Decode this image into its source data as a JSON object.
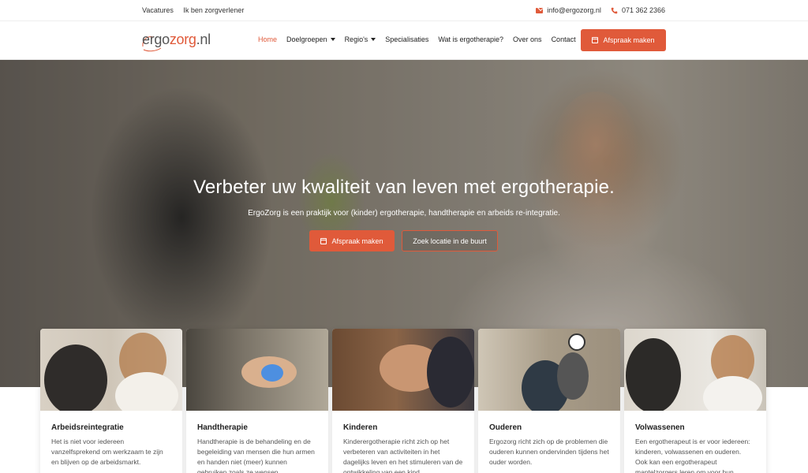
{
  "topbar": {
    "links": [
      "Vacatures",
      "Ik ben zorgverlener"
    ],
    "email": "info@ergozorg.nl",
    "phone": "071 362 2366"
  },
  "logo": {
    "text_a": "ergo",
    "text_b": "zorg",
    "text_c": ".nl"
  },
  "nav": {
    "home": "Home",
    "doelgroepen": "Doelgroepen",
    "regios": "Regio's",
    "specialisaties": "Specialisaties",
    "wat": "Wat is ergotherapie?",
    "over": "Over ons",
    "contact": "Contact",
    "cta": "Afspraak maken"
  },
  "hero": {
    "title": "Verbeter uw kwaliteit van leven met ergotherapie.",
    "subtitle": "ErgoZorg is een praktijk voor (kinder) ergotherapie, handtherapie en arbeids re-integratie.",
    "primary_button": "Afspraak maken",
    "secondary_button": "Zoek locatie in de buurt"
  },
  "cards": [
    {
      "title": "Arbeidsreintegratie",
      "text": "Het is niet voor iedereen vanzelfsprekend om werkzaam te zijn en blijven op de arbeidsmarkt."
    },
    {
      "title": "Handtherapie",
      "text": "Handtherapie is de behandeling en de begeleiding van mensen die hun armen en handen niet (meer) kunnen gebruiken zoals ze wensen."
    },
    {
      "title": "Kinderen",
      "text": "Kinderergotherapie richt zich op het verbeteren van activiteiten in het dagelijks leven en het stimuleren van de ontwikkeling van een kind."
    },
    {
      "title": "Ouderen",
      "text": "Ergozorg richt zich op de problemen die ouderen kunnen ondervinden tijdens het ouder worden."
    },
    {
      "title": "Volwassenen",
      "text": "Een ergotherapeut is er voor iedereen: kinderen, volwassenen en ouderen. Ook kan een ergotherapeut mantelzorgers leren om voor hun naasten te zorgen."
    }
  ],
  "colors": {
    "accent": "#e05a3a"
  }
}
